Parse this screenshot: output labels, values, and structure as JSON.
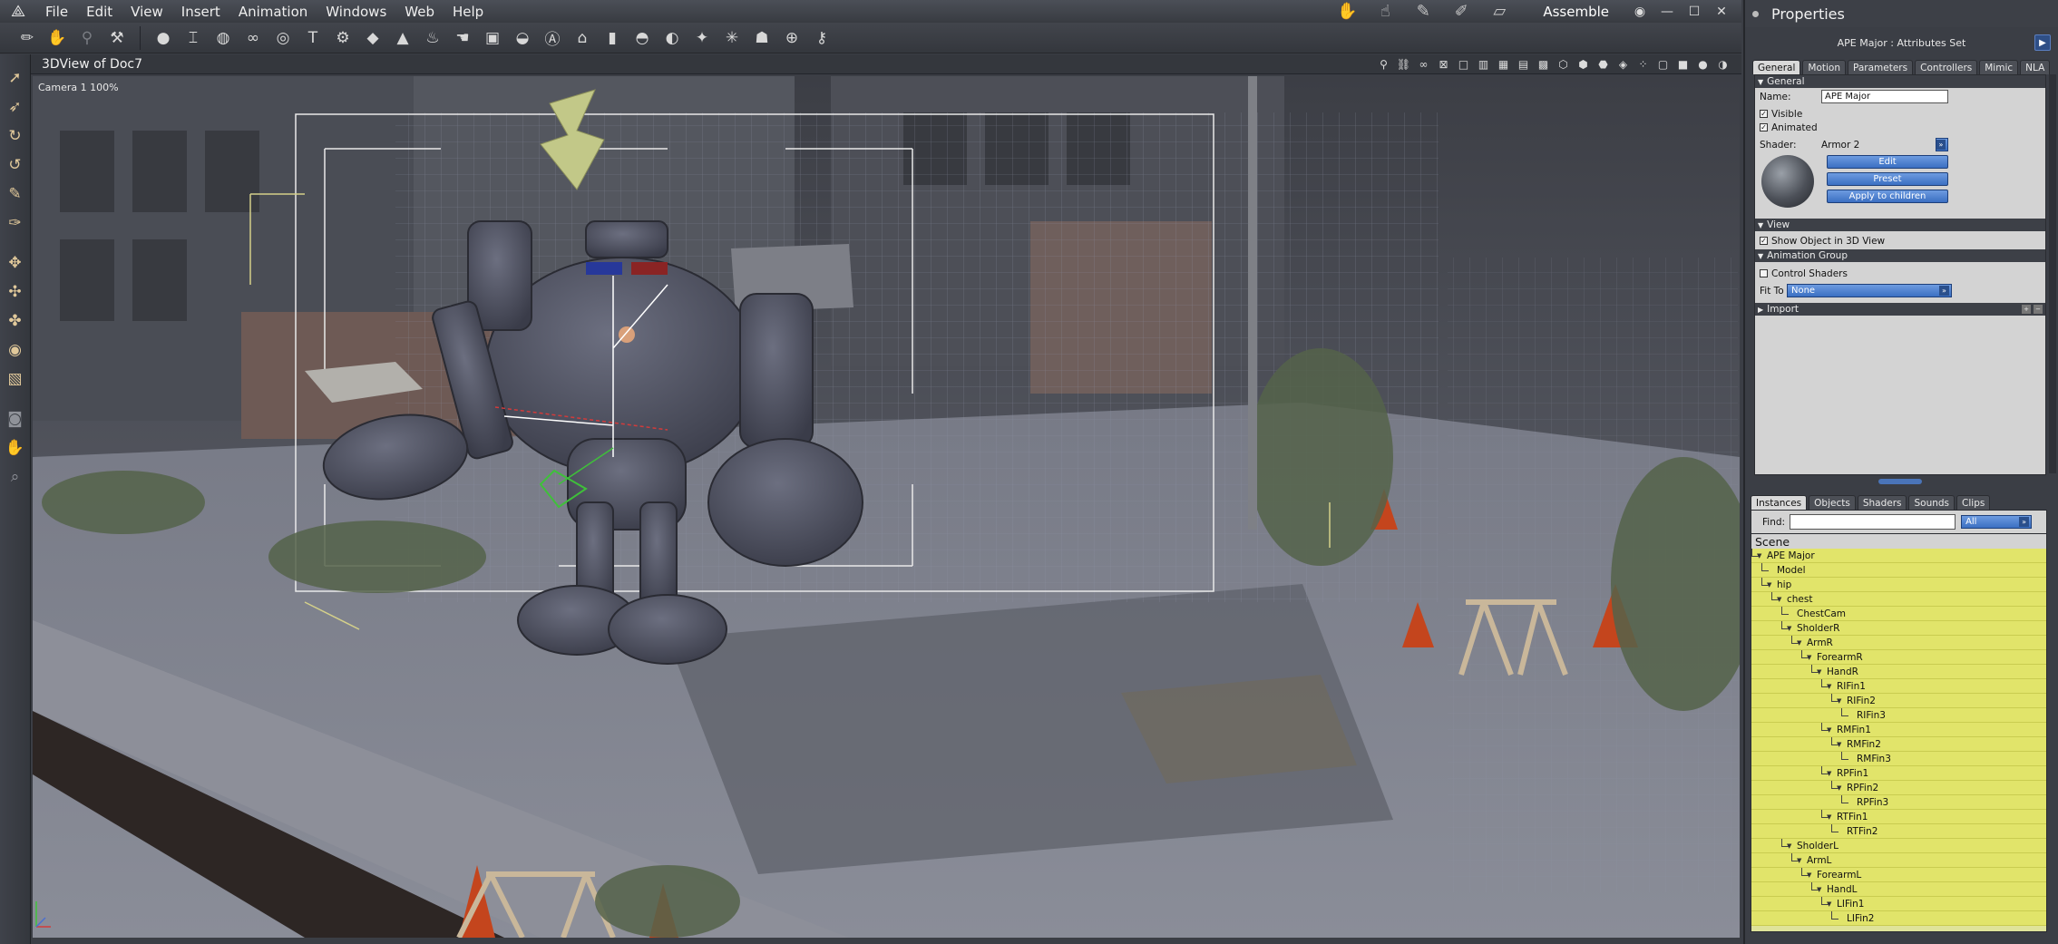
{
  "menubar": {
    "logo_icon": "app-logo-icon",
    "menus": [
      "File",
      "Edit",
      "View",
      "Insert",
      "Animation",
      "Windows",
      "Web",
      "Help"
    ],
    "room_label": "Assemble",
    "room_icons": [
      "hand-icon",
      "pose-icon",
      "brush-icon",
      "pencil-icon",
      "ruler-icon"
    ]
  },
  "toolbar": {
    "icons": [
      "draw-icon",
      "hand-disabled-icon",
      "pin-disabled-icon",
      "hammer-icon",
      "sphere-icon",
      "column-icon",
      "globe-icon",
      "chain-icon",
      "ring-icon",
      "text-icon",
      "gear-icon",
      "plane-icon",
      "cone-icon",
      "lamp-icon",
      "hand-icon",
      "cube-icon",
      "dish-icon",
      "agt-icon",
      "house-icon",
      "capsule-icon",
      "pot-icon",
      "meat-icon",
      "spark-icon",
      "tree-icon",
      "figure-icon",
      "target-icon",
      "wrench-icon"
    ]
  },
  "lefttools": {
    "icons": [
      "select-arrow-icon",
      "move-select-icon",
      "rotate-icon",
      "twist-icon",
      "pencil-tool-icon",
      "paint-icon",
      "move-icon",
      "scale-icon",
      "spin-icon",
      "sphere-tool-icon",
      "box-tool-icon",
      "camera-icon",
      "pan-hand-icon",
      "zoom-icon"
    ]
  },
  "viewport": {
    "title": "3DView of Doc7",
    "camera_label": "Camera 1 100%"
  },
  "properties": {
    "panel_title": "Properties",
    "subtitle": "APE Major : Attributes Set",
    "tabs": [
      "General",
      "Motion",
      "Parameters",
      "Controllers",
      "Mimic",
      "NLA"
    ],
    "general_section": "General",
    "name_label": "Name:",
    "name_value": "APE Major",
    "visible_label": "Visible",
    "animated_label": "Animated",
    "shader_label": "Shader:",
    "shader_value": "Armor 2",
    "edit_label": "Edit",
    "preset_label": "Preset",
    "apply_label": "Apply to children",
    "view_section": "View",
    "show_object_label": "Show Object in 3D View",
    "animation_group_section": "Animation Group",
    "control_shaders_label": "Control Shaders",
    "fit_to_label": "Fit To",
    "fit_to_value": "None",
    "import_section": "Import"
  },
  "browser": {
    "tabs": [
      "Instances",
      "Objects",
      "Shaders",
      "Sounds",
      "Clips"
    ],
    "find_label": "Find:",
    "filter_value": "All",
    "scene_label": "Scene",
    "tree": [
      {
        "label": "APE Major",
        "depth": 0
      },
      {
        "label": "Model",
        "depth": 1
      },
      {
        "label": "hip",
        "depth": 1
      },
      {
        "label": "chest",
        "depth": 2
      },
      {
        "label": "ChestCam",
        "depth": 3
      },
      {
        "label": "SholderR",
        "depth": 3
      },
      {
        "label": "ArmR",
        "depth": 4
      },
      {
        "label": "ForearmR",
        "depth": 5
      },
      {
        "label": "HandR",
        "depth": 6
      },
      {
        "label": "RIFin1",
        "depth": 7
      },
      {
        "label": "RIFin2",
        "depth": 8
      },
      {
        "label": "RIFin3",
        "depth": 9
      },
      {
        "label": "RMFin1",
        "depth": 7
      },
      {
        "label": "RMFin2",
        "depth": 8
      },
      {
        "label": "RMFin3",
        "depth": 9
      },
      {
        "label": "RPFin1",
        "depth": 7
      },
      {
        "label": "RPFin2",
        "depth": 8
      },
      {
        "label": "RPFin3",
        "depth": 9
      },
      {
        "label": "RTFin1",
        "depth": 7
      },
      {
        "label": "RTFin2",
        "depth": 8
      },
      {
        "label": "SholderL",
        "depth": 3
      },
      {
        "label": "ArmL",
        "depth": 4
      },
      {
        "label": "ForearmL",
        "depth": 5
      },
      {
        "label": "HandL",
        "depth": 6
      },
      {
        "label": "LIFin1",
        "depth": 7
      },
      {
        "label": "LIFin2",
        "depth": 8
      }
    ]
  },
  "colors": {
    "accent_blue": "#3b6fc2",
    "tree_yellow": "#e1e46a",
    "panel_bg": "#d3d3d3"
  }
}
